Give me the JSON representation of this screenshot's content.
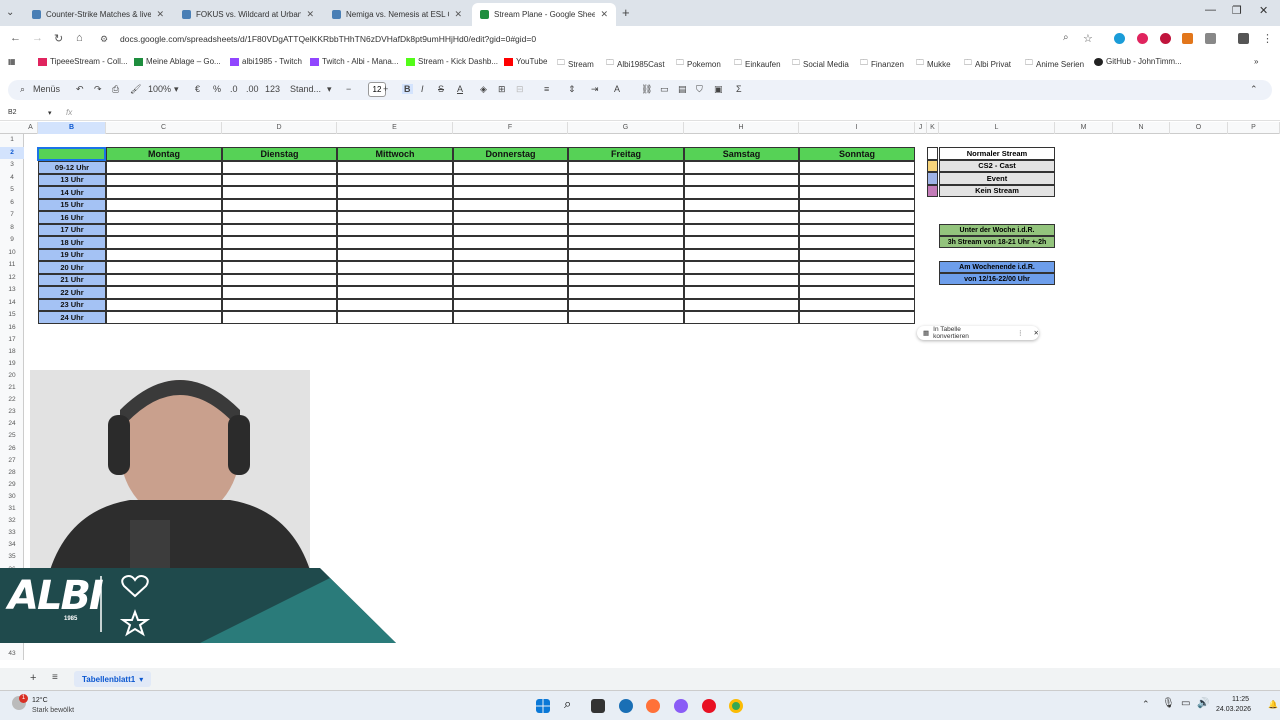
{
  "browser": {
    "tabs": [
      {
        "title": "Counter-Strike Matches & livesc",
        "color": "#4a7fb5"
      },
      {
        "title": "FOKUS vs. Wildcard at Urban Ri",
        "color": "#4a7fb5"
      },
      {
        "title": "Nemiga vs. Nemesis at ESL Cha",
        "color": "#4a7fb5"
      },
      {
        "title": "Stream Plane - Google Sheets",
        "color": "#1e8e3e"
      }
    ],
    "url": "docs.google.com/spreadsheets/d/1F80VDgATTQelKKRbbTHhTN6zDVHafDk8pt9umHHjHd0/edit?gid=0#gid=0",
    "bookmarks": [
      "TipeeeStream - Coll...",
      "Meine Ablage – Go...",
      "albi1985 - Twitch",
      "Twitch - Albi - Mana...",
      "Stream - Kick Dashb...",
      "YouTube",
      "Stream",
      "Albi1985Cast",
      "Pokemon",
      "Einkaufen",
      "Social Media",
      "Finanzen",
      "Mukke",
      "Albi Privat",
      "Anime Serien",
      "GitHub - JohnTimm..."
    ]
  },
  "toolbar": {
    "menus": "Menüs",
    "zoom": "100%",
    "currency": "€",
    "percent": "%",
    "dec_less": ".0",
    "dec_more": ".00",
    "number_fmt": "123",
    "font": "Stand...",
    "font_size": "12",
    "bold": "B",
    "italic": "I",
    "sigma": "Σ"
  },
  "formula_bar": {
    "name_box": "B2",
    "fx": "fx"
  },
  "grid": {
    "columns": [
      "A",
      "B",
      "C",
      "D",
      "E",
      "F",
      "G",
      "H",
      "I",
      "J",
      "K",
      "L",
      "M",
      "N",
      "O",
      "P"
    ],
    "rows": [
      "1",
      "2",
      "3",
      "4",
      "5",
      "6",
      "7",
      "8",
      "9",
      "10",
      "11",
      "12",
      "13",
      "14",
      "15",
      "16",
      "17",
      "18",
      "19",
      "20",
      "21",
      "22",
      "23",
      "24",
      "25",
      "26",
      "27",
      "28",
      "29",
      "30",
      "31",
      "32",
      "33",
      "34",
      "35",
      "36",
      "37",
      "38",
      "39",
      "40",
      "41",
      "42",
      "43"
    ],
    "selected_col": "B",
    "selected_row": "2"
  },
  "schedule": {
    "days": [
      "Montag",
      "Dienstag",
      "Mittwoch",
      "Donnerstag",
      "Freitag",
      "Samstag",
      "Sonntag"
    ],
    "times": [
      "09-12 Uhr",
      "13 Uhr",
      "14 Uhr",
      "15 Uhr",
      "16 Uhr",
      "17 Uhr",
      "18 Uhr",
      "19 Uhr",
      "20 Uhr",
      "21 Uhr",
      "22 Uhr",
      "23 Uhr",
      "24 Uhr"
    ]
  },
  "legend": [
    {
      "label": "Normaler Stream",
      "color": "#ffffff"
    },
    {
      "label": "CS2 - Cast",
      "color": "#f6d37a"
    },
    {
      "label": "Event",
      "color": "#9fb3e6"
    },
    {
      "label": "Kein Stream",
      "color": "#c37cb8"
    }
  ],
  "notes": {
    "weekday_line1": "Unter der Woche i.d.R.",
    "weekday_line2": "3h Stream von 18-21 Uhr +-2h",
    "weekend_line1": "Am Wochenende i.d.R.",
    "weekend_line2": "von 12/16-22/00 Uhr"
  },
  "chip": {
    "label": "In Tabelle konvertieren"
  },
  "sheet": {
    "tab_name": "Tabellenblatt1"
  },
  "overlay": {
    "logo_text": "ALBI",
    "logo_year": "1985"
  },
  "taskbar": {
    "weather_temp": "12°C",
    "weather_desc": "Stark bewölkt",
    "weather_badge": "1",
    "time": "11:25",
    "date": "24.03.2026"
  }
}
